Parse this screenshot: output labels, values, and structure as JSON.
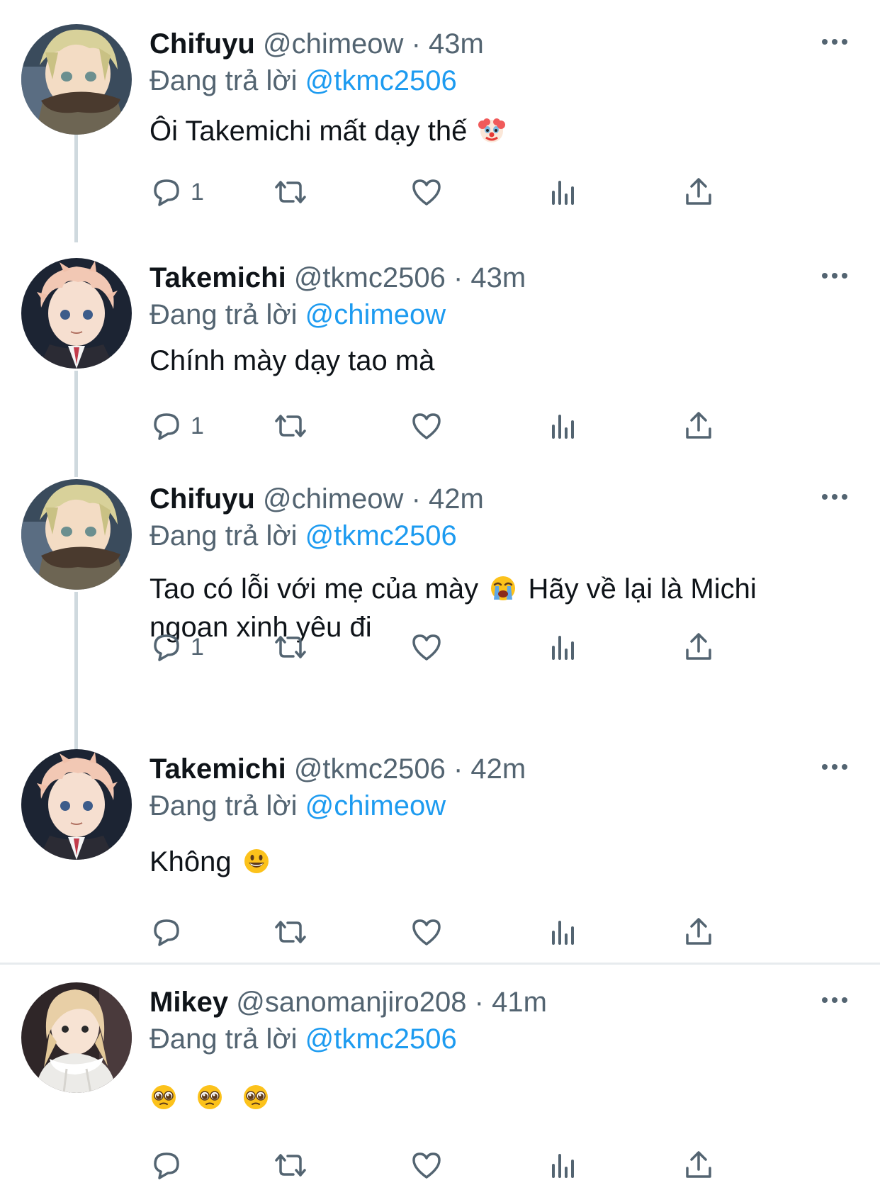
{
  "reply_prefix": "Đang trả lời",
  "colors": {
    "accent": "#1d9bf0",
    "text": "#0f1419",
    "secondary": "#536471",
    "thread_line": "#cfd9de"
  },
  "tweets": [
    {
      "name": "Chifuyu",
      "handle": "@chimeow",
      "separator": "·",
      "time": "43m",
      "reply_to": "@tkmc2506",
      "text": "Ôi Takemichi mất dạy thế",
      "emoji": "clown-face-emoji",
      "reply_count": "1"
    },
    {
      "name": "Takemichi",
      "handle": "@tkmc2506",
      "separator": "·",
      "time": "43m",
      "reply_to": "@chimeow",
      "text": "Chính mày dạy tao mà",
      "reply_count": "1"
    },
    {
      "name": "Chifuyu",
      "handle": "@chimeow",
      "separator": "·",
      "time": "42m",
      "reply_to": "@tkmc2506",
      "text_part1": "Tao có lỗi với mẹ của mày",
      "emoji": "loudly-crying-face-emoji",
      "text_part2": "Hãy về lại là Michi ngoan xinh yêu đi",
      "reply_count": "1"
    },
    {
      "name": "Takemichi",
      "handle": "@tkmc2506",
      "separator": "·",
      "time": "42m",
      "reply_to": "@chimeow",
      "text": "Không",
      "emoji": "grinning-face-emoji",
      "reply_count": ""
    },
    {
      "name": "Mikey",
      "handle": "@sanomanjiro208",
      "separator": "·",
      "time": "41m",
      "reply_to": "@tkmc2506",
      "emoji": "pleading-face-emoji",
      "emoji_count": 3,
      "reply_count": ""
    }
  ]
}
